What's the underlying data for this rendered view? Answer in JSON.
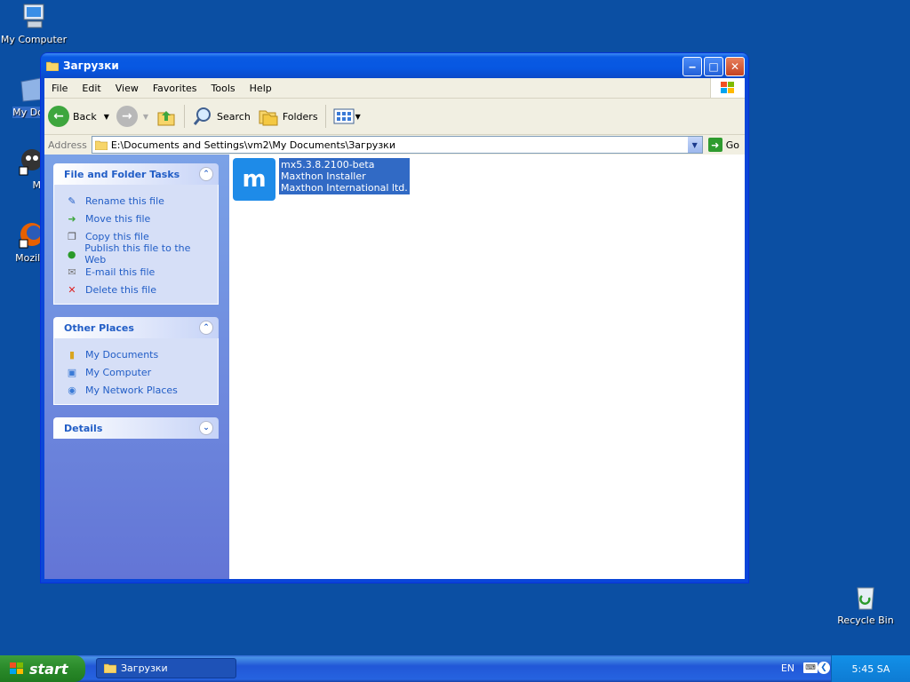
{
  "desktop": {
    "icons": [
      {
        "label": "My Computer"
      },
      {
        "label": "My Docu"
      },
      {
        "label": "Myp"
      },
      {
        "label": "Mozilla F"
      },
      {
        "label": "Recycle Bin"
      }
    ]
  },
  "window": {
    "title": "Загрузки",
    "menu": [
      "File",
      "Edit",
      "View",
      "Favorites",
      "Tools",
      "Help"
    ],
    "toolbar": {
      "back": "Back",
      "search": "Search",
      "folders": "Folders"
    },
    "address": {
      "label": "Address",
      "value": "E:\\Documents and Settings\\vm2\\My Documents\\Загрузки",
      "go": "Go"
    },
    "file_tasks": {
      "title": "File and Folder Tasks",
      "items": [
        "Rename this file",
        "Move this file",
        "Copy this file",
        "Publish this file to the Web",
        "E-mail this file",
        "Delete this file"
      ]
    },
    "other_places": {
      "title": "Other Places",
      "items": [
        "My Documents",
        "My Computer",
        "My Network Places"
      ]
    },
    "details": {
      "title": "Details"
    },
    "file": {
      "name": "mx5.3.8.2100-beta",
      "description": "Maxthon Installer",
      "company": "Maxthon International ltd."
    }
  },
  "taskbar": {
    "start": "start",
    "task_button": "Загрузки",
    "language": "EN",
    "clock": "5:45 SA"
  },
  "colors": {
    "desktop": "#0b4fa3",
    "link": "#215dc6",
    "selection": "#316ac5"
  }
}
